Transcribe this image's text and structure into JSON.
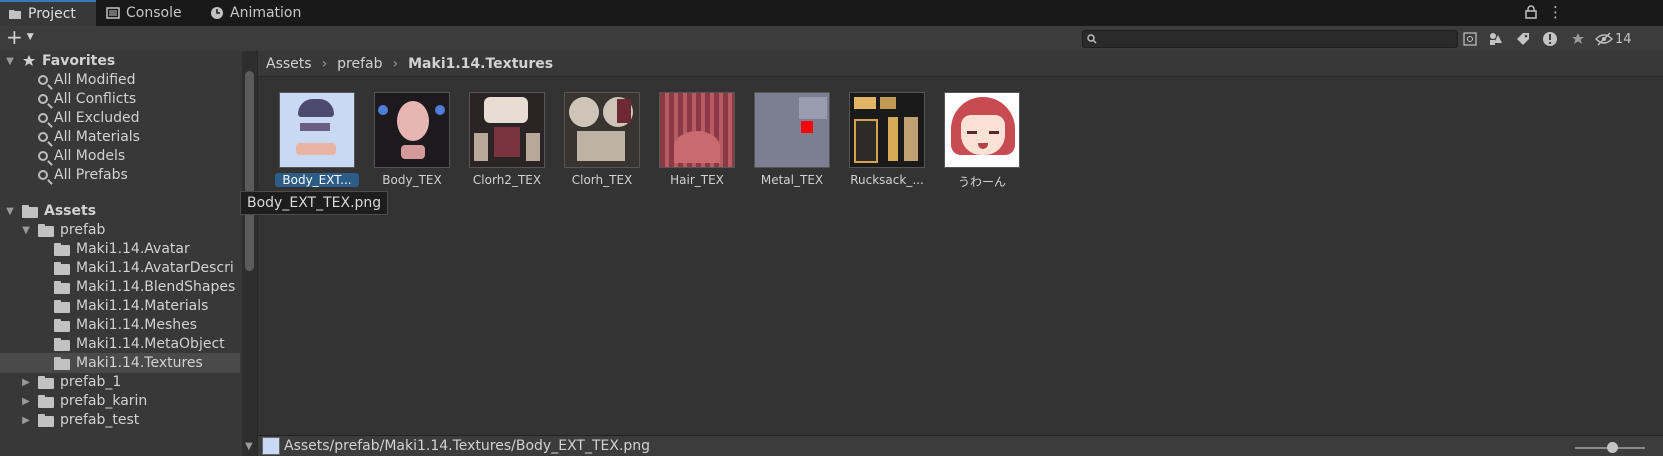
{
  "tabs": [
    {
      "label": "Project",
      "icon": "folder-icon",
      "active": true
    },
    {
      "label": "Console",
      "icon": "console-icon",
      "active": false
    },
    {
      "label": "Animation",
      "icon": "animation-clock-icon",
      "active": false
    }
  ],
  "window_controls": {
    "menu_glyph": "⋮",
    "lock_icon": "lock-icon"
  },
  "toolbar": {
    "add_label": "+",
    "search_placeholder": "",
    "hidden_count": "14",
    "icons": [
      "search-by-type-icon",
      "filter-by-label-icon",
      "filter-by-log-icon",
      "favorite-star-icon",
      "hidden-packages-icon"
    ]
  },
  "favorites": {
    "header": "Favorites",
    "items": [
      "All Modified",
      "All Conflicts",
      "All Excluded",
      "All Materials",
      "All Models",
      "All Prefabs"
    ]
  },
  "assets": {
    "header": "Assets",
    "prefab": "prefab",
    "prefab_children": [
      "Maki1.14.Avatar",
      "Maki1.14.AvatarDescri",
      "Maki1.14.BlendShapes",
      "Maki1.14.Materials",
      "Maki1.14.Meshes",
      "Maki1.14.MetaObject",
      "Maki1.14.Textures"
    ],
    "siblings": [
      "prefab_1",
      "prefab_karin",
      "prefab_test"
    ],
    "selected_folder": "Maki1.14.Textures"
  },
  "breadcrumb": [
    "Assets",
    "prefab",
    "Maki1.14.Textures"
  ],
  "thumbnails": [
    {
      "label": "Body_EXT...",
      "selected": true,
      "color": "#c9d9f5"
    },
    {
      "label": "Body_TEX",
      "selected": false,
      "color": "#1c1a1c"
    },
    {
      "label": "Clorh2_TEX",
      "selected": false,
      "color": "#2a2424"
    },
    {
      "label": "Clorh_TEX",
      "selected": false,
      "color": "#3a3430"
    },
    {
      "label": "Hair_TEX",
      "selected": false,
      "color": "#8a3a44"
    },
    {
      "label": "Metal_TEX",
      "selected": false,
      "color": "#7c7f92"
    },
    {
      "label": "Rucksack_...",
      "selected": false,
      "color": "#1a1a1a"
    },
    {
      "label": "うわーん",
      "selected": false,
      "color": "#ffffff"
    }
  ],
  "tooltip": "Body_EXT_TEX.png",
  "status_path": "Assets/prefab/Maki1.14.Textures/Body_EXT_TEX.png",
  "colors": {
    "accent": "#3a79bb",
    "selection": "#2c5d87",
    "panel": "#383838",
    "background": "#282828"
  }
}
